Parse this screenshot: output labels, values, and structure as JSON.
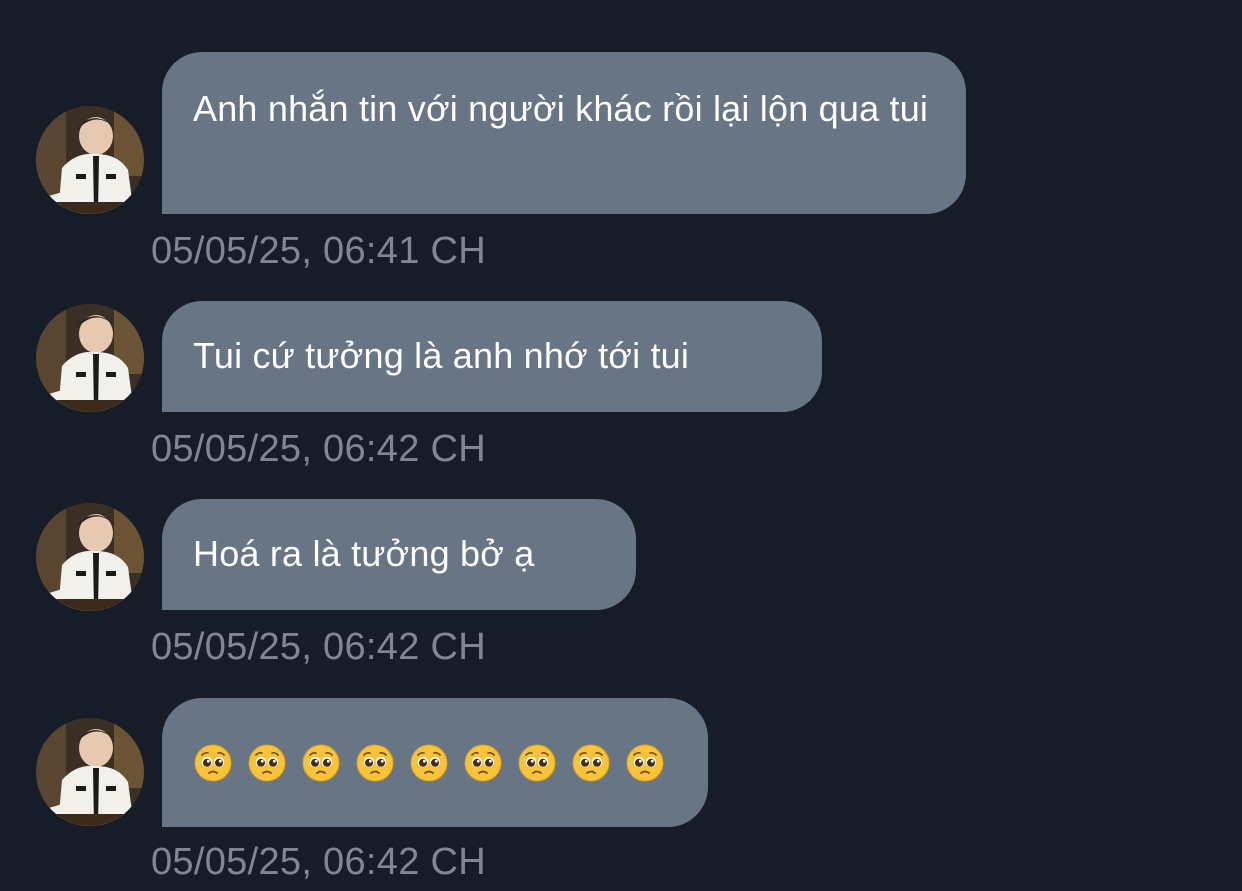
{
  "colors": {
    "background": "#171d28",
    "bubble": "#687584",
    "bubble_text": "#ffffff",
    "timestamp": "#7e8894"
  },
  "messages": [
    {
      "text": "Anh nhắn tin với người khác rồi lại lộn qua tui",
      "time": "05/05/25, 06:41 CH"
    },
    {
      "text": "Tui cứ tưởng là anh nhớ tới tui",
      "time": "05/05/25, 06:42 CH"
    },
    {
      "text": "Hoá ra là tưởng bở ạ",
      "time": "05/05/25, 06:42 CH"
    },
    {
      "emoji_name": "pleading-face-emoji",
      "emoji_count": 9,
      "time": "05/05/25, 06:42 CH"
    }
  ]
}
